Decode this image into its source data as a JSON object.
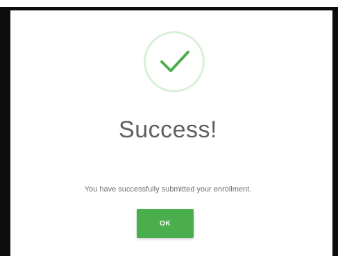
{
  "dialog": {
    "icon": "checkmark-icon",
    "title": "Success!",
    "message": "You have successfully submitted your enrollment.",
    "ok_label": "OK"
  },
  "colors": {
    "accent_green": "#4aae4e",
    "circle_ring": "#d9efd9",
    "frame": "#0d0d0d"
  }
}
